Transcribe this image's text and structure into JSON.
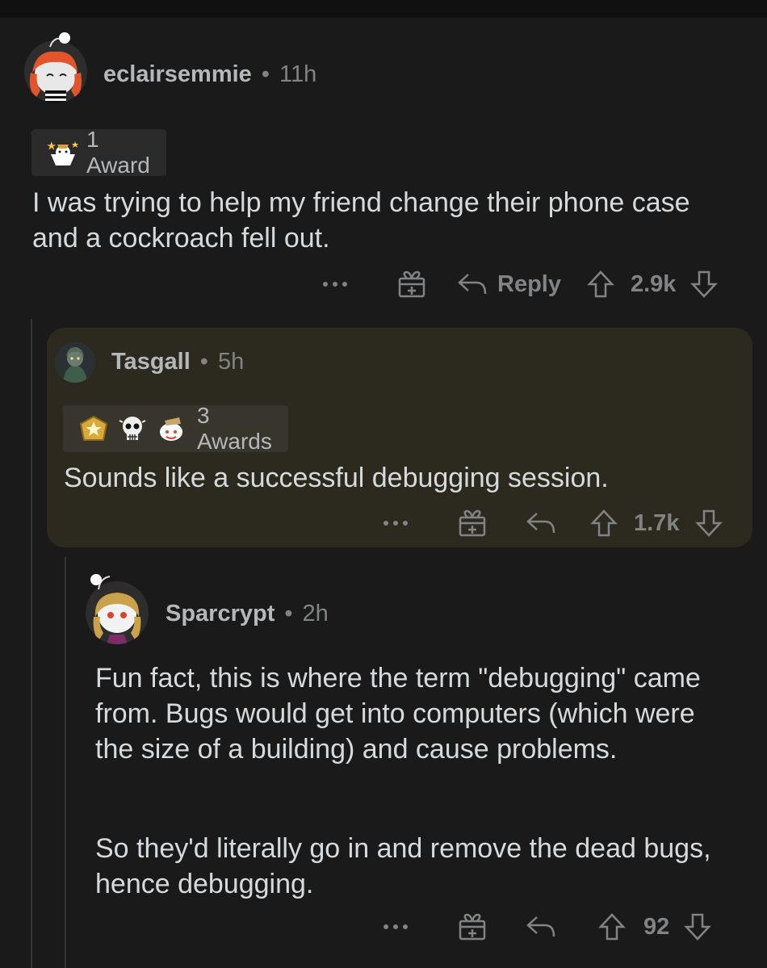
{
  "comments": [
    {
      "username": "eclairsemmie",
      "separator": "•",
      "time": "11h",
      "awards_label": "1 Award",
      "text": "I was trying to help my friend change their phone case and a cockroach fell out.",
      "reply_label": "Reply",
      "score": "2.9k"
    },
    {
      "username": "Tasgall",
      "separator": "•",
      "time": "5h",
      "awards_label": "3 Awards",
      "text": "Sounds like a successful debugging session.",
      "score": "1.7k"
    },
    {
      "username": "Sparcrypt",
      "separator": "•",
      "time": "2h",
      "paragraphs": [
        "Fun fact, this is where the term \"debugging\" came from. Bugs would get into computers (which were the size of a building) and cause problems.",
        "So they'd literally go in and remove the dead bugs, hence debugging."
      ],
      "score": "92"
    }
  ],
  "icons": {
    "more": "more-options-icon",
    "gift": "gift-award-icon",
    "reply": "reply-arrow-icon",
    "upvote": "upvote-arrow-icon",
    "downvote": "downvote-arrow-icon"
  },
  "colors": {
    "background": "#1a1a1b",
    "highlight_card": "#2c2a1f",
    "text": "#d7dadc",
    "meta": "#818384"
  }
}
